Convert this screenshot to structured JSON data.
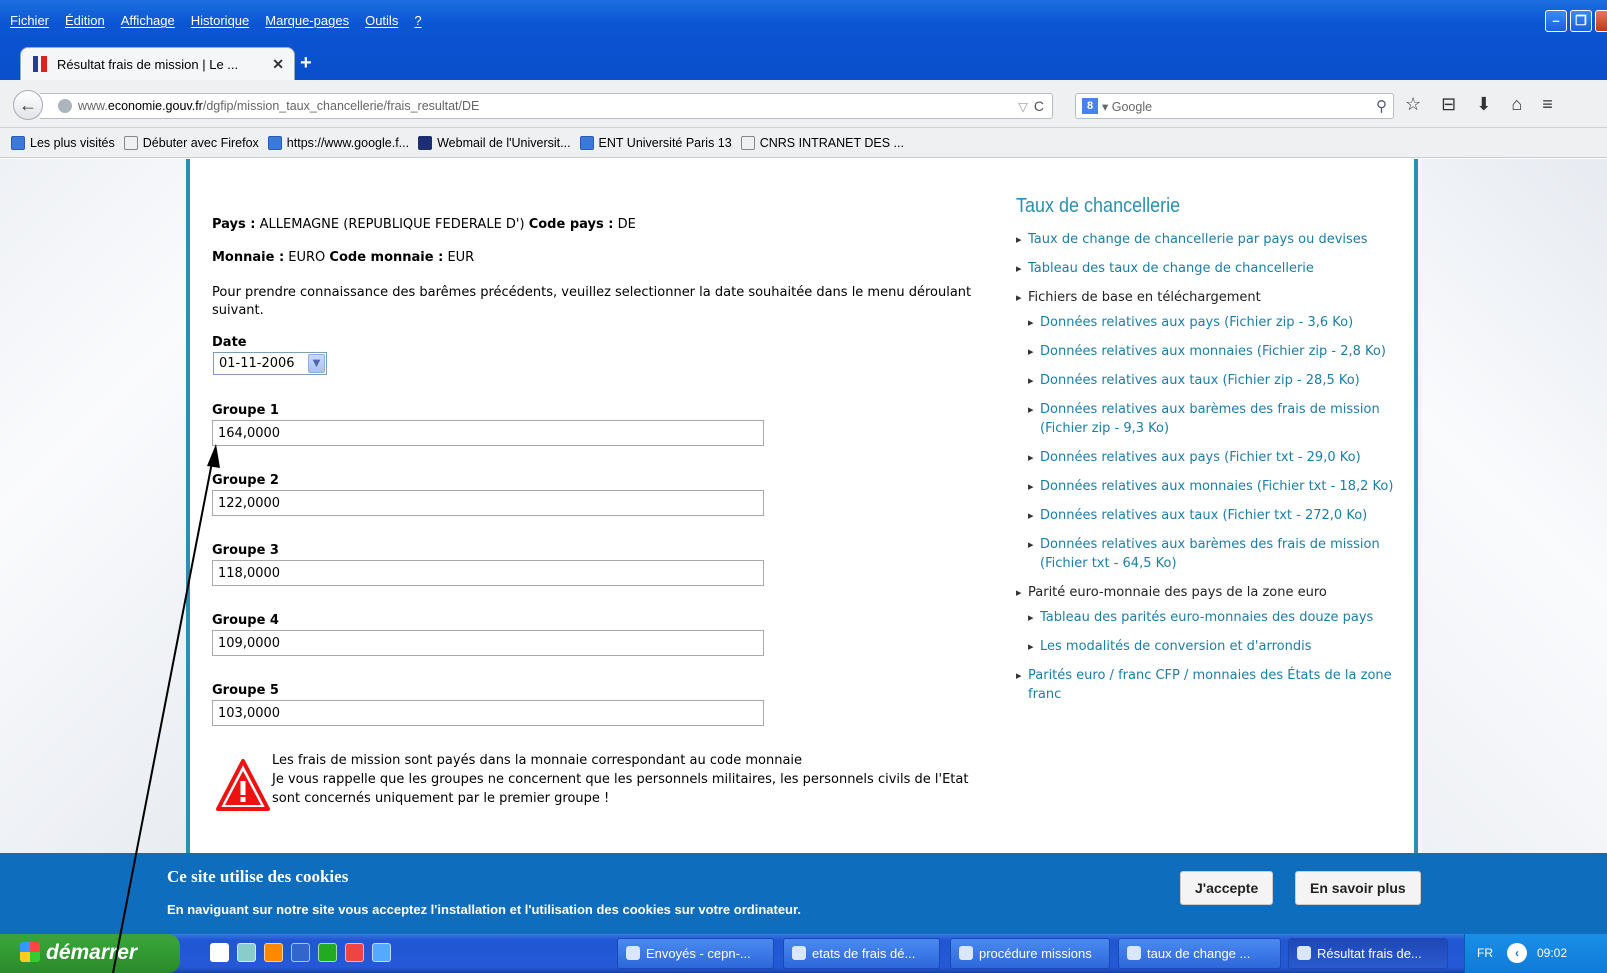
{
  "menubar": [
    "Fichier",
    "Édition",
    "Affichage",
    "Historique",
    "Marque-pages",
    "Outils",
    "?"
  ],
  "tab": {
    "title": "Résultat frais de mission | Le ...",
    "close": "✕"
  },
  "new_tab": "+",
  "nav": {
    "back": "←",
    "url_prefix": "www.",
    "url_domain": "economie.gouv.fr",
    "url_path": "/dgfip/mission_taux_chancellerie/frais_resultat/DE",
    "url_drop": "▽",
    "reload": "C",
    "search_engine": "8",
    "search_placeholder": "▾ Google",
    "search_icon": "⚲",
    "icons": [
      "☆",
      "⊟",
      "⬇",
      "⌂",
      "≡"
    ]
  },
  "bookmarks": [
    {
      "label": "Les plus visités",
      "icon": "blue"
    },
    {
      "label": "Débuter avec Firefox",
      "icon": "blank"
    },
    {
      "label": "https://www.google.f...",
      "icon": "blue"
    },
    {
      "label": "Webmail de l'Universit...",
      "icon": "dark"
    },
    {
      "label": "ENT Université Paris 13",
      "icon": "blue"
    },
    {
      "label": "CNRS INTRANET DES ...",
      "icon": "blank"
    }
  ],
  "main": {
    "pays_label": "Pays :",
    "pays_value": " ALLEMAGNE (REPUBLIQUE FEDERALE D') ",
    "code_pays_label": "Code pays :",
    "code_pays_value": " DE",
    "monnaie_label": "Monnaie :",
    "monnaie_value": " EURO ",
    "code_monnaie_label": "Code monnaie :",
    "code_monnaie_value": " EUR",
    "intro": "Pour prendre connaissance des barêmes précédents, veuillez selectionner la date souhaitée dans le menu déroulant suivant.",
    "date_label": "Date",
    "date_value": "01-11-2006",
    "groups": [
      {
        "label": "Groupe 1",
        "value": "164,0000"
      },
      {
        "label": "Groupe 2",
        "value": "122,0000"
      },
      {
        "label": "Groupe 3",
        "value": "118,0000"
      },
      {
        "label": "Groupe 4",
        "value": "109,0000"
      },
      {
        "label": "Groupe 5",
        "value": "103,0000"
      }
    ],
    "warning": [
      "Les frais de mission sont payés dans la monnaie correspondant au code monnaie",
      "Je vous rappelle que les groupes ne concernent que les personnels militaires, les personnels civils de l'Etat",
      "sont concernés uniquement par le premier groupe !"
    ]
  },
  "sidebar": {
    "title": "Taux de chancellerie",
    "items": [
      {
        "label": "Taux de change de chancellerie par pays ou devises",
        "level": 0,
        "link": true
      },
      {
        "label": "Tableau des taux de change de chancellerie",
        "level": 0,
        "link": true
      },
      {
        "label": "Fichiers de base en téléchargement",
        "level": 0,
        "link": false
      },
      {
        "label": "Données relatives aux pays (Fichier zip - 3,6 Ko)",
        "level": 1,
        "link": true
      },
      {
        "label": "Données relatives aux monnaies (Fichier zip - 2,8 Ko)",
        "level": 1,
        "link": true
      },
      {
        "label": "Données relatives aux taux (Fichier zip - 28,5 Ko)",
        "level": 1,
        "link": true
      },
      {
        "label": "Données relatives aux barèmes des frais de mission (Fichier zip - 9,3 Ko)",
        "level": 1,
        "link": true
      },
      {
        "label": "Données relatives aux pays (Fichier txt - 29,0 Ko)",
        "level": 1,
        "link": true
      },
      {
        "label": "Données relatives aux monnaies (Fichier txt - 18,2 Ko)",
        "level": 1,
        "link": true
      },
      {
        "label": "Données relatives aux taux (Fichier txt - 272,0 Ko)",
        "level": 1,
        "link": true
      },
      {
        "label": "Données relatives aux barèmes des frais de mission (Fichier txt - 64,5 Ko)",
        "level": 1,
        "link": true
      },
      {
        "label": "Parité euro-monnaie des pays de la zone euro",
        "level": 0,
        "link": false
      },
      {
        "label": "Tableau des parités euro-monnaies des douze pays",
        "level": 1,
        "link": true
      },
      {
        "label": "Les modalités de conversion et d'arrondis",
        "level": 1,
        "link": true
      },
      {
        "label": "Parités euro / franc CFP / monnaies des États de la zone franc",
        "level": 0,
        "link": true
      }
    ]
  },
  "cookie": {
    "title": "Ce site utilise des cookies",
    "text": "En naviguant sur notre site vous acceptez l'installation et l'utilisation des cookies sur votre ordinateur.",
    "accept": "J'accepte",
    "more": "En savoir plus"
  },
  "taskbar": {
    "start": "démarrer",
    "tasks": [
      {
        "label": "Envoyés - cepn-...",
        "active": false
      },
      {
        "label": "etats de frais dé...",
        "active": false
      },
      {
        "label": "procédure missions",
        "active": false
      },
      {
        "label": "taux de change ...",
        "active": false
      },
      {
        "label": "Résultat frais de...",
        "active": true
      }
    ],
    "lang": "FR",
    "clock": "09:02"
  },
  "colors": {
    "accent": "#2a8fb0",
    "link": "#1b7ea6",
    "cookie_bg": "#0e6dbd",
    "titlebar": "#0a4fcb"
  }
}
